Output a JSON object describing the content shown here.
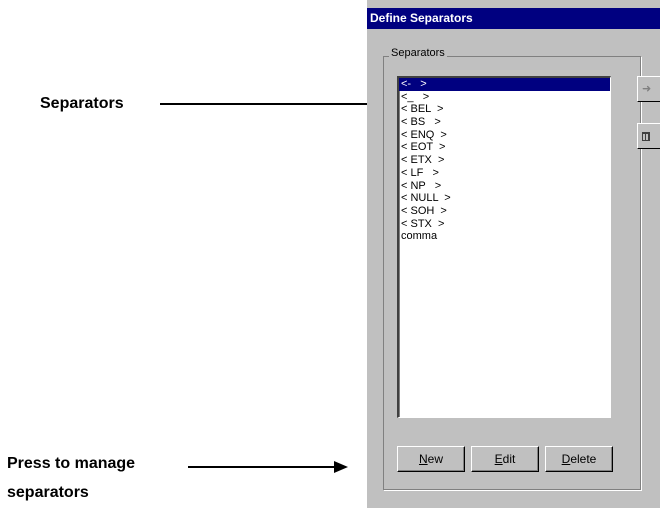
{
  "annotations": {
    "separators_label": "Separators",
    "manage_line1": "Press to manage",
    "manage_line2": "separators"
  },
  "dialog": {
    "title": "Define Separators",
    "group_label": "Separators",
    "items": [
      "<-   >",
      "<_   >",
      "< BEL  >",
      "< BS   >",
      "< ENQ  >",
      "< EOT  >",
      "< ETX  >",
      "< LF   >",
      "< NP   >",
      "< NULL  >",
      "< SOH  >",
      "< STX  >",
      "comma"
    ],
    "selected_index": 0,
    "buttons": {
      "new": "New",
      "new_mnemonic": "N",
      "edit": "Edit",
      "edit_mnemonic": "E",
      "delete": "Delete",
      "delete_mnemonic": "D"
    },
    "side_icons": [
      "arrow-right-icon",
      "trash-icon"
    ]
  },
  "colors": {
    "titlebar": "#000080",
    "selection": "#000080",
    "face": "#c0c0c0"
  }
}
